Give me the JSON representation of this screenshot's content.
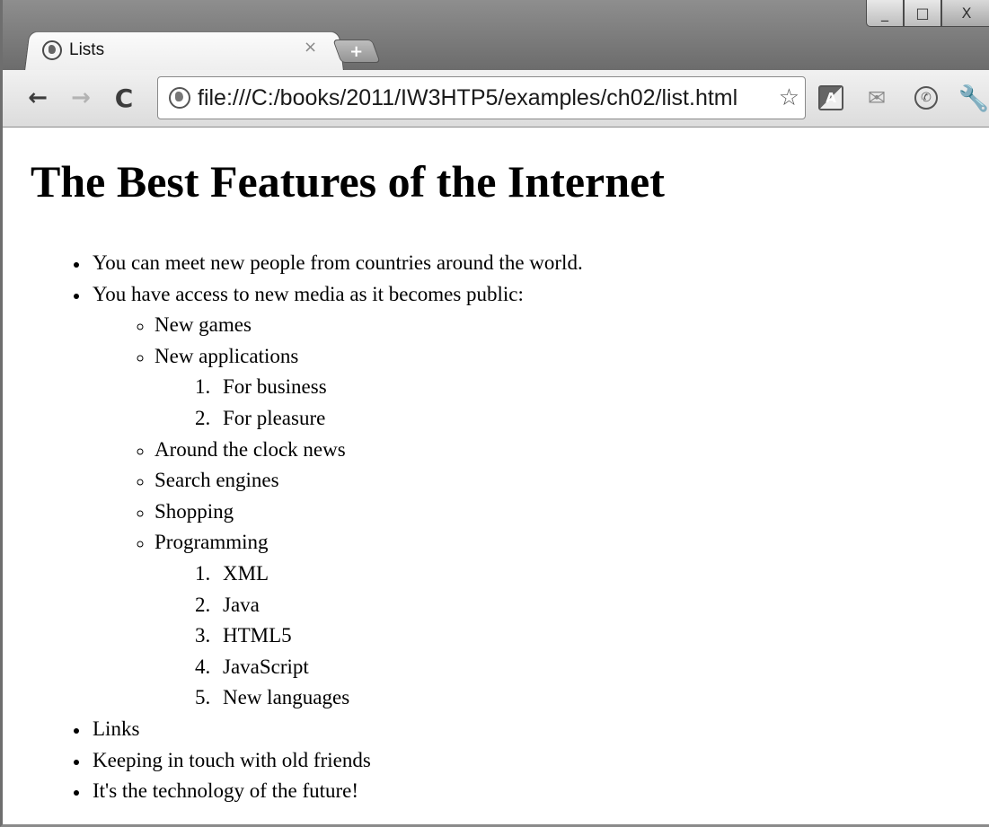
{
  "browser": {
    "tab_title": "Lists",
    "tab_close": "×",
    "new_tab": "+",
    "window_controls": {
      "minimize": "_",
      "maximize": "□",
      "close": "X"
    },
    "nav": {
      "back": "←",
      "forward": "→",
      "reload": "C"
    },
    "address": "file:///C:/books/2011/IW3HTP5/examples/ch02/list.html",
    "star": "☆",
    "icons": [
      "translate-icon",
      "mail-icon",
      "phone-icon",
      "wrench-icon"
    ],
    "translate_glyph": "A",
    "mail_glyph": "✉",
    "phone_glyph": "✆",
    "wrench_glyph": "🔧"
  },
  "page": {
    "heading": "The Best Features of the Internet",
    "items": {
      "0": "You can meet new people from countries around the world.",
      "1": "You have access to new media as it becomes public:",
      "sub": {
        "0": "New games",
        "1": "New applications",
        "apps": {
          "0": "For business",
          "1": "For pleasure"
        },
        "2": "Around the clock news",
        "3": "Search engines",
        "4": "Shopping",
        "5": "Programming",
        "prog": {
          "0": "XML",
          "1": "Java",
          "2": "HTML5",
          "3": "JavaScript",
          "4": "New languages"
        }
      },
      "2": "Links",
      "3": "Keeping in touch with old friends",
      "4": "It's the technology of the future!"
    }
  }
}
